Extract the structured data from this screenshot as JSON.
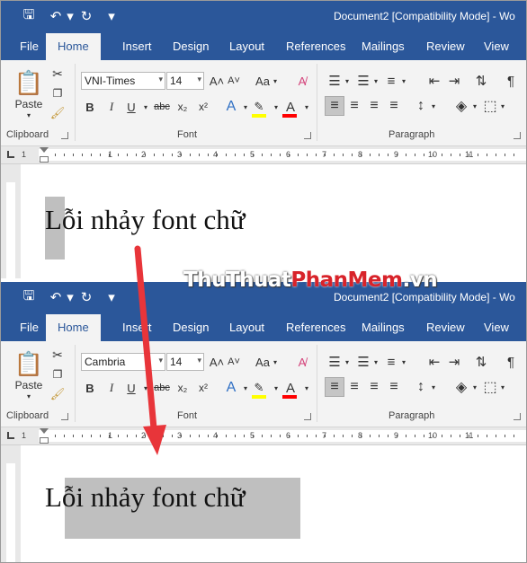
{
  "title": "Document2 [Compatibility Mode] - Wo",
  "tabs": [
    "File",
    "Home",
    "Insert",
    "Design",
    "Layout",
    "References",
    "Mailings",
    "Review",
    "View"
  ],
  "active_tab": "Home",
  "groups": {
    "clipboard": "Clipboard",
    "font": "Font",
    "paragraph": "Paragraph"
  },
  "paste_label": "Paste",
  "font_size": "14",
  "ruler_numbers": [
    "1",
    "1",
    "2",
    "3",
    "4",
    "5",
    "6",
    "7",
    "8",
    "9",
    "10",
    "11"
  ],
  "panels": [
    {
      "font_name": "VNI-Times",
      "doc_text": "Lỗi nhảy font chữ",
      "highlight": "first-character"
    },
    {
      "font_name": "Cambria",
      "doc_text": "Lỗi nhảy font chữ",
      "highlight": "rest-of-line"
    }
  ],
  "watermark": {
    "part1": "ThuThuat",
    "part2": "PhanMem",
    "part3": ".vn"
  },
  "colors": {
    "title_bar": "#2b579a",
    "ribbon": "#f3f3f3",
    "arrow": "#e8353a",
    "selection": "#bfbfbf",
    "highlighter": "#ffff00",
    "font_color": "#ff0000"
  },
  "icons": [
    "save-icon",
    "undo-icon",
    "redo-icon",
    "customize-qat-icon",
    "paste-icon",
    "cut-icon",
    "copy-icon",
    "format-painter-icon",
    "bold-icon",
    "italic-icon",
    "underline-icon",
    "strikethrough-icon",
    "subscript-icon",
    "superscript-icon",
    "grow-font-icon",
    "shrink-font-icon",
    "change-case-icon",
    "clear-formatting-icon",
    "text-effects-icon",
    "highlight-icon",
    "font-color-icon",
    "bullets-icon",
    "numbering-icon",
    "multilevel-list-icon",
    "decrease-indent-icon",
    "increase-indent-icon",
    "sort-icon",
    "show-marks-icon",
    "align-left-icon",
    "center-icon",
    "align-right-icon",
    "justify-icon",
    "line-spacing-icon",
    "shading-icon",
    "borders-icon",
    "arrow-icon"
  ]
}
